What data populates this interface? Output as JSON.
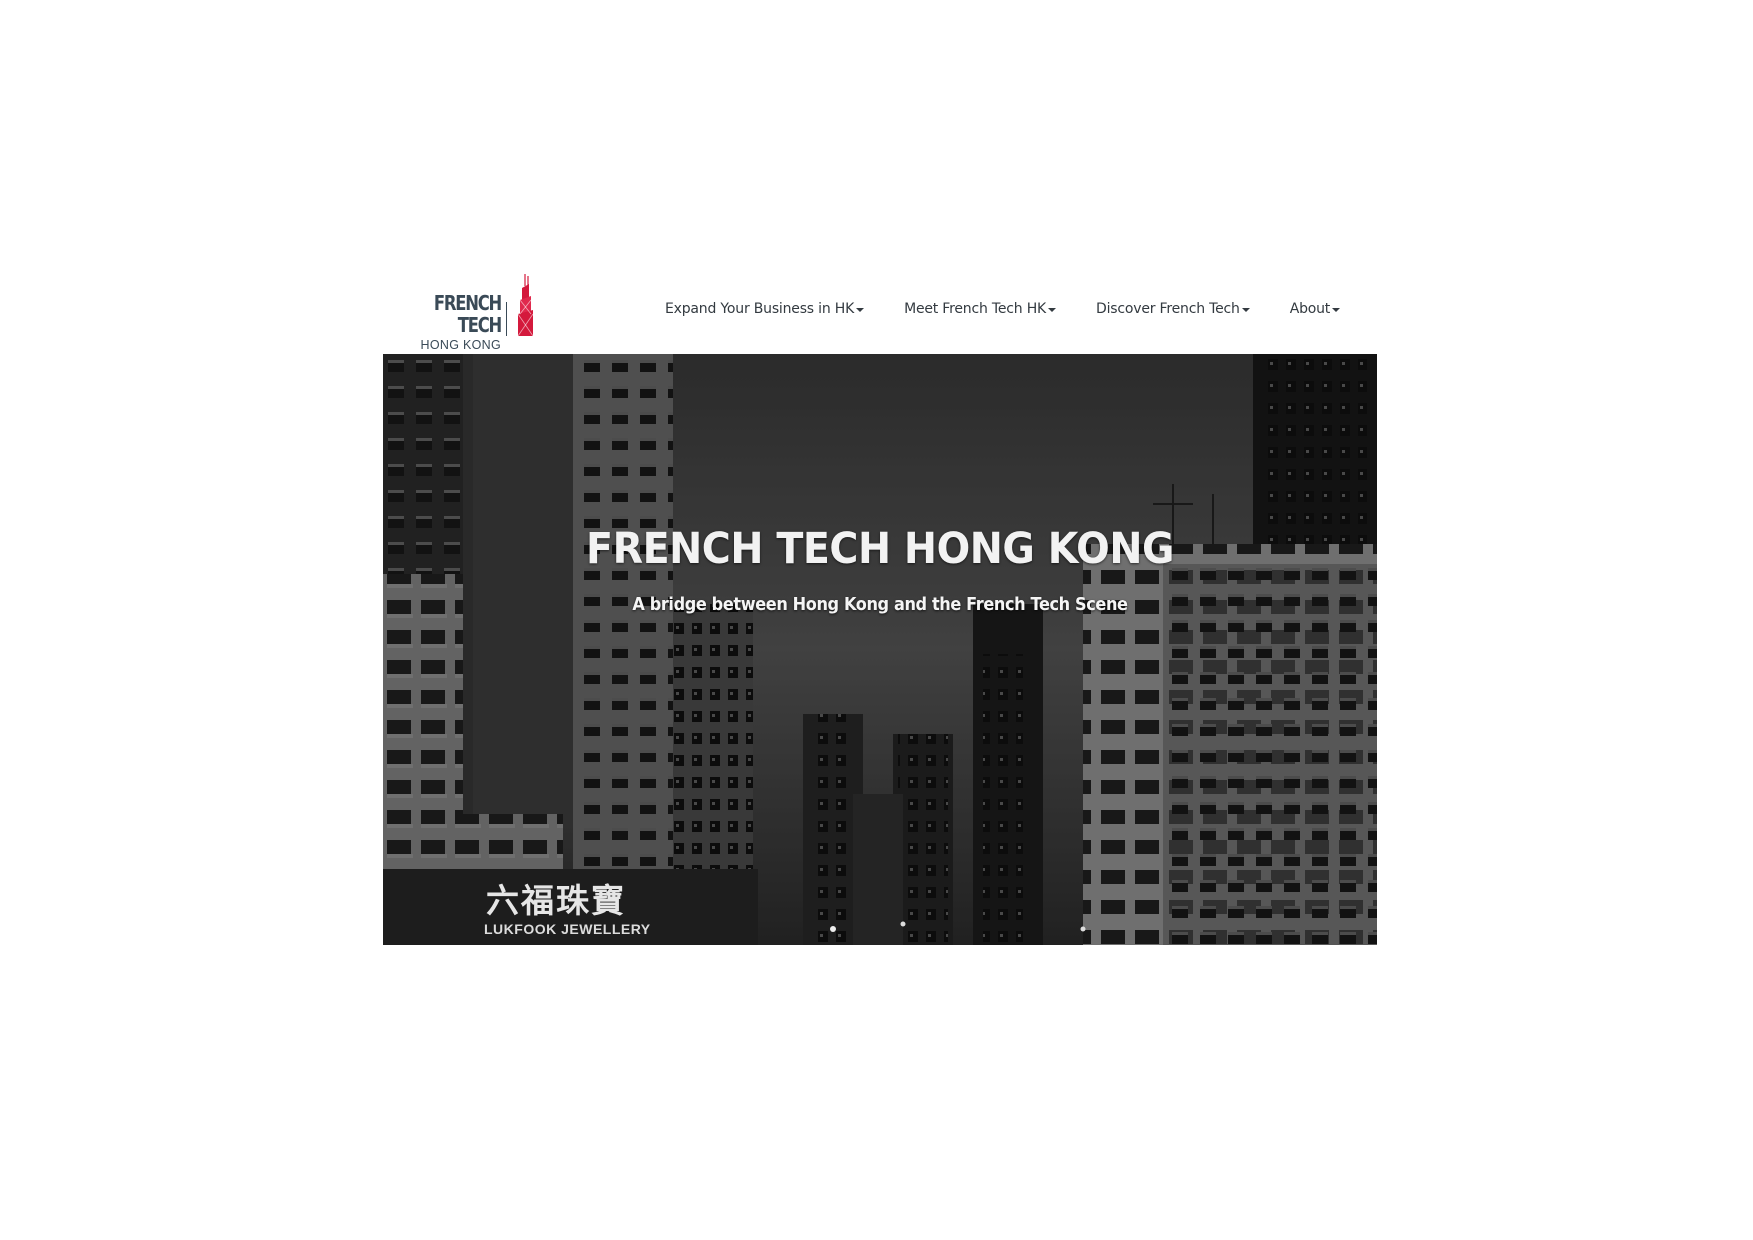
{
  "logo": {
    "main": "FRENCH TECH",
    "sub": "HONG KONG",
    "tower_color": "#d4193c"
  },
  "nav": {
    "items": [
      {
        "label": "Expand Your Business in HK"
      },
      {
        "label": "Meet French Tech HK"
      },
      {
        "label": "Discover French Tech"
      },
      {
        "label": "About"
      }
    ]
  },
  "hero": {
    "title": "FRENCH TECH HONG KONG",
    "subtitle": "A bridge between Hong Kong and the French Tech Scene",
    "sign_chinese": "六福珠寶",
    "sign_english": "LUKFOOK JEWELLERY"
  }
}
